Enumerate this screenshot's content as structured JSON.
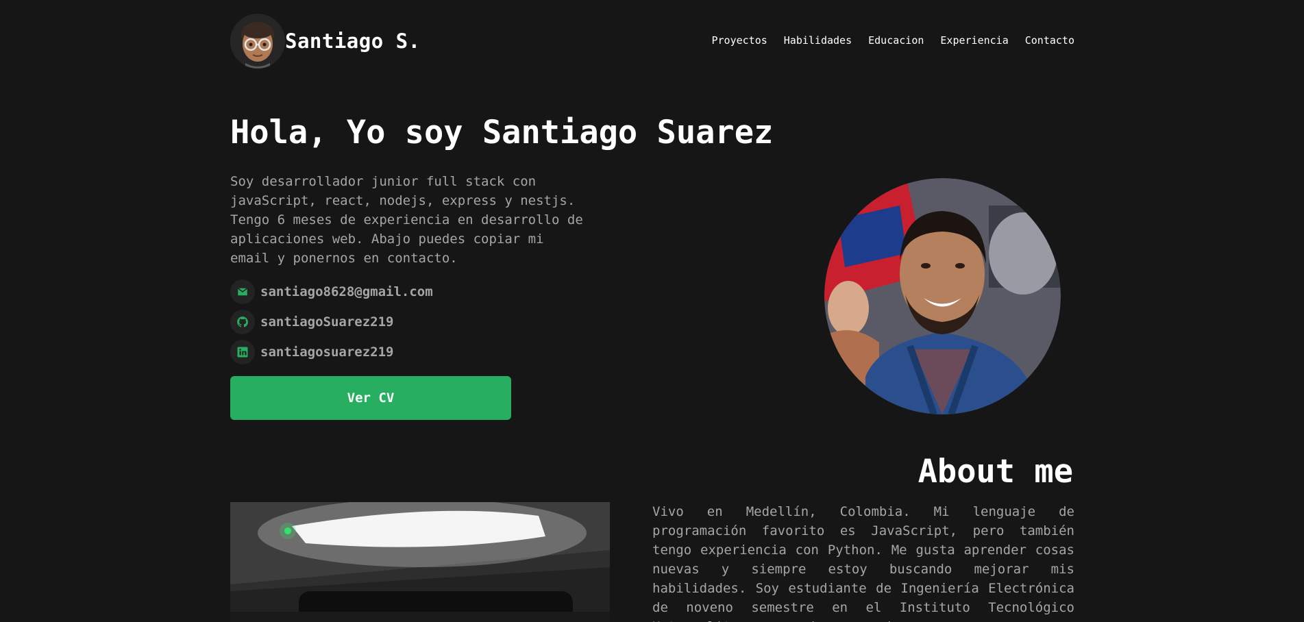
{
  "navbar": {
    "brand_name": "Santiago S.",
    "brand_avatar_icon": "memoji-avatar-icon",
    "links": [
      "Proyectos",
      "Habilidades",
      "Educacion",
      "Experiencia",
      "Contacto"
    ]
  },
  "hero": {
    "title": "Hola, Yo soy Santiago Suarez",
    "description": "Soy desarrollador junior full stack con javaScript, react, nodejs, express y nestjs. Tengo 6 meses de experiencia en desarrollo de aplicaciones web. Abajo puedes copiar mi email y ponernos en contacto.",
    "contacts": [
      {
        "icon": "mail-icon",
        "text": "santiago8628@gmail.com"
      },
      {
        "icon": "github-icon",
        "text": "santiagoSuarez219"
      },
      {
        "icon": "linkedin-icon",
        "text": "santiagosuarez219"
      }
    ],
    "cv_button_label": "Ver CV"
  },
  "about": {
    "title": "About me",
    "text": "Vivo en Medellín, Colombia. Mi lenguaje de programación favorito es JavaScript, pero también tengo experiencia con Python. Me gusta aprender cosas nuevas y siempre estoy buscando mejorar mis habilidades. Soy estudiante de Ingeniería Electrónica de noveno semestre en el Instituto Tecnológico Metropolitano y en mi carrera he"
  },
  "colors": {
    "background": "#161616",
    "accent": "#27ae60",
    "text_primary": "#ffffff",
    "text_secondary": "#a6a6a6"
  }
}
